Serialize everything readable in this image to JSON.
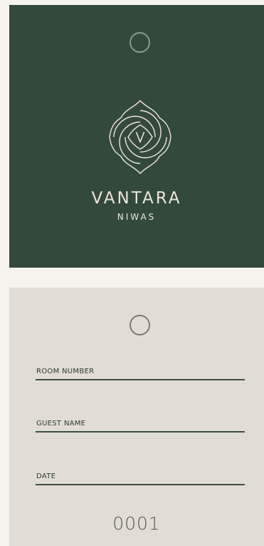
{
  "front": {
    "brand_name": "VANTARA",
    "brand_sub": "NIWAS",
    "emblem_icon": "lotus-knot-monogram-icon",
    "emblem_letter": "V",
    "background_color": "#33493c",
    "foreground_color": "#ece6da"
  },
  "back": {
    "fields": [
      {
        "label": "ROOM NUMBER"
      },
      {
        "label": "GUEST NAME"
      },
      {
        "label": "DATE"
      }
    ],
    "serial_number": "0001",
    "background_color": "#e2ddd4"
  }
}
